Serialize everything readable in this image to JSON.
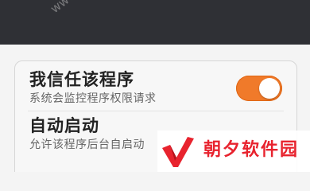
{
  "settings": {
    "trust_app": {
      "title": "我信任该程序",
      "subtitle": "系统会监控程序权限请求",
      "enabled": true
    },
    "auto_start": {
      "title": "自动启动",
      "subtitle": "允许该程序后台自启动"
    }
  },
  "colors": {
    "title_bar": "#2f3035",
    "toggle_on": "#f07a2a",
    "brand_red": "#e8232e"
  },
  "watermark": {
    "site": "www.cckhome.com",
    "brand_name": "朝夕软件园"
  },
  "icons": {
    "brand_logo": "red-checkmark-logo"
  }
}
